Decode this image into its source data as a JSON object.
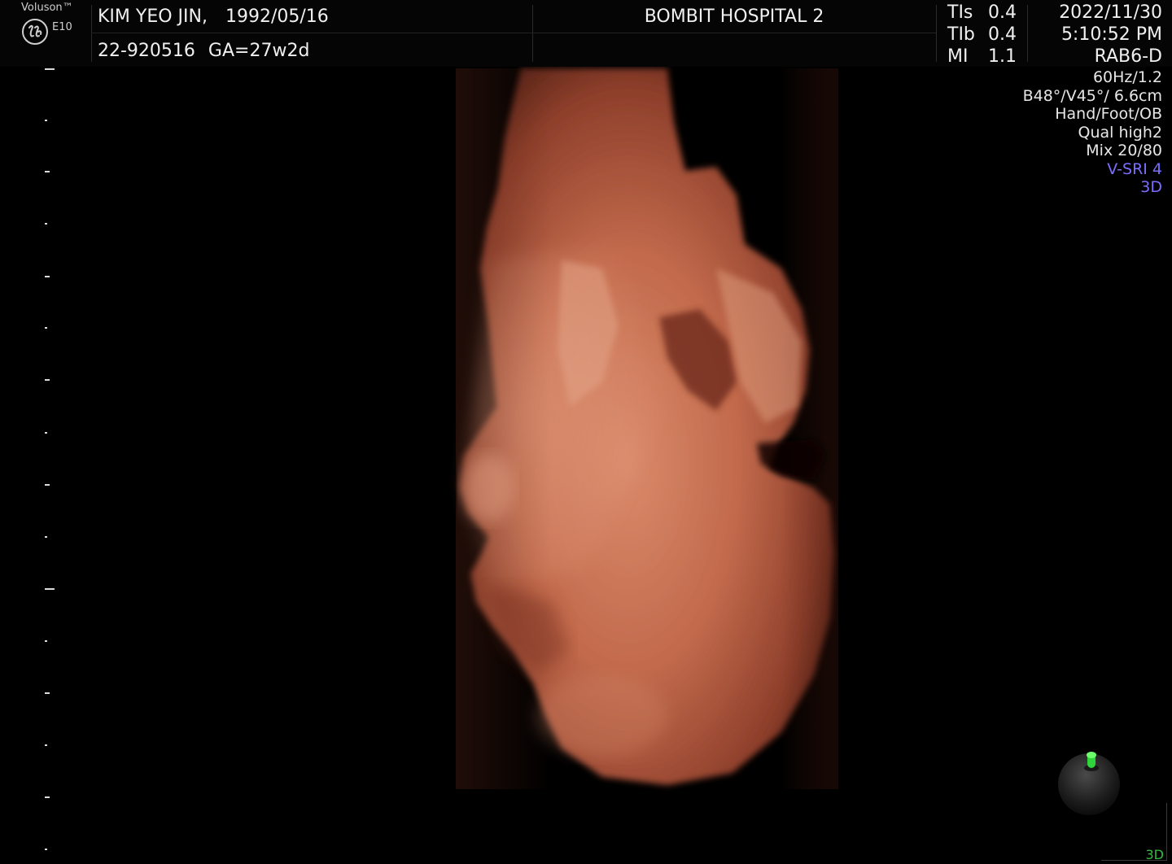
{
  "brand": {
    "name": "Voluson™",
    "model": "E10",
    "logo_icon": "ge-logo-icon"
  },
  "patient": {
    "name": "KIM YEO JIN,",
    "dob": "1992/05/16",
    "id": "22-920516",
    "ga": "GA=27w2d"
  },
  "hospital": "BOMBIT HOSPITAL 2",
  "indices": [
    {
      "label": "TIs",
      "value": "0.4"
    },
    {
      "label": "TIb",
      "value": "0.4"
    },
    {
      "label": "MI",
      "value": "1.1"
    }
  ],
  "datetime": {
    "date": "2022/11/30",
    "time": "5:10:52 PM",
    "probe": "RAB6-D"
  },
  "params": {
    "frequency": "60Hz/1.2",
    "angle_depth": "B48°/V45°/ 6.6cm",
    "preset": "Hand/Foot/OB",
    "quality": "Qual high2",
    "mix": "Mix 20/80",
    "vsri": "V-SRI 4",
    "mode": "3D"
  },
  "corner_mode": "3D",
  "colors": {
    "background": "#000000",
    "accent": "#7a6dff",
    "tissue": "#c4684a",
    "orientation_marker": "#2fd43a"
  }
}
